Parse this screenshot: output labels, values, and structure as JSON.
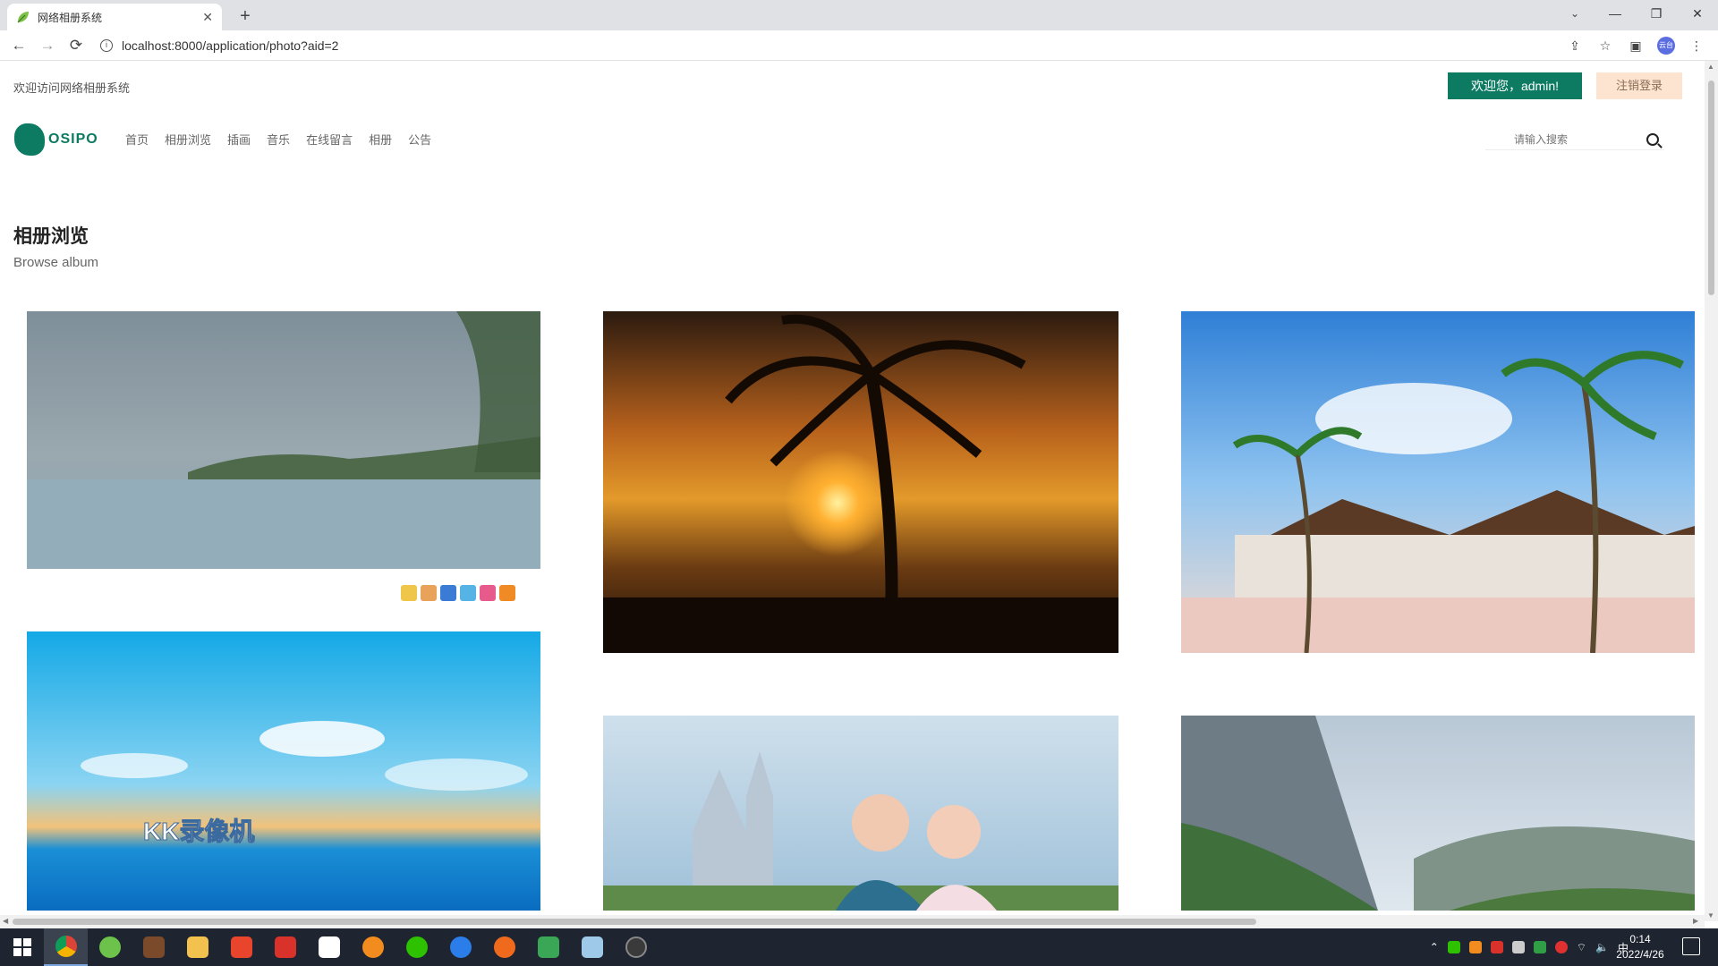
{
  "browser": {
    "tab_title": "网络相册系统",
    "url": "localhost:8000/application/photo?aid=2",
    "new_tab": "+",
    "close": "✕",
    "minimize": "—",
    "restore": "❐",
    "window_close": "✕",
    "tabs_dropdown": "⌄",
    "back": "←",
    "forward": "→",
    "reload": "⟳",
    "profile_label": "云台"
  },
  "header": {
    "welcome_text": "欢迎访问网络相册系统",
    "user_button": "欢迎您，admin!",
    "logout_button": "注销登录",
    "logo_text": "OSIPO",
    "nav": [
      "首页",
      "相册浏览",
      "插画",
      "音乐",
      "在线留言",
      "相册",
      "公告"
    ],
    "search_placeholder": "请输入搜索"
  },
  "section": {
    "title": "相册浏览",
    "subtitle": "Browse album"
  },
  "photos": [
    {
      "alt": "lake landscape"
    },
    {
      "alt": "sunset palm tree"
    },
    {
      "alt": "beach resort palms"
    },
    {
      "alt": "sea and sky",
      "caption": "KK录像机"
    },
    {
      "alt": "castle girls"
    },
    {
      "alt": "mountain valley"
    }
  ],
  "taskbar": {
    "time": "0:14",
    "date": "2022/4/26",
    "ime": "中"
  },
  "colors": {
    "accent": "#0d7a62",
    "logout_bg": "#fde4d0"
  }
}
